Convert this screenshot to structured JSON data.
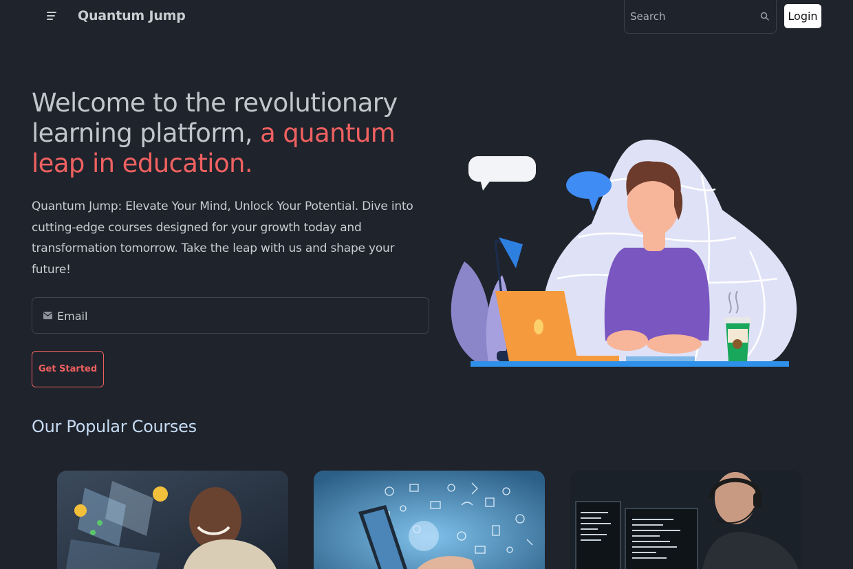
{
  "header": {
    "brand": "Quantum Jump",
    "search_placeholder": "Search",
    "login_label": "Login"
  },
  "hero": {
    "title_plain": "Welcome to the revolutionary learning platform,",
    "title_accent": "a quantum leap in education.",
    "description": "Quantum Jump: Elevate Your Mind, Unlock Your Potential. Dive into cutting-edge courses designed for your growth today and transformation tomorrow. Take the leap with us and shape your future!",
    "email_placeholder": "Email",
    "cta_label": "Get Started"
  },
  "courses": {
    "title": "Our Popular Courses"
  },
  "icons": {
    "menu": "menu-icon",
    "search": "search-icon",
    "email": "envelope-icon"
  },
  "colors": {
    "background": "#1f232b",
    "accent": "#f06161",
    "section_title": "#c7dcf5"
  }
}
